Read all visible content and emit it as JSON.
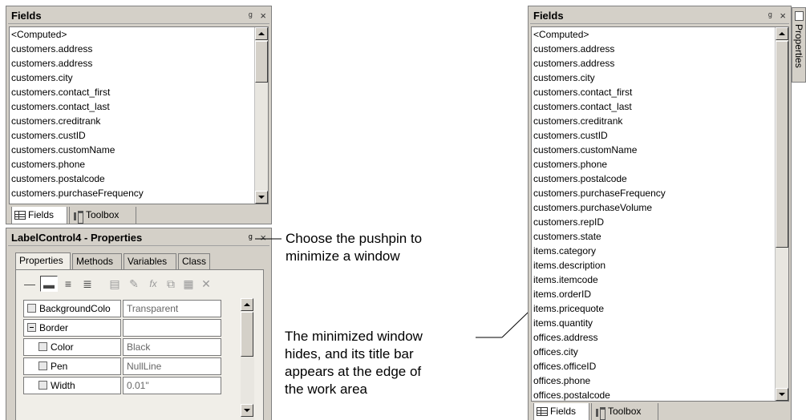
{
  "left_fields": {
    "title": "Fields",
    "pin": "p",
    "close": "×",
    "items": [
      "<Computed>",
      "customers.address",
      "customers.address",
      "customers.city",
      "customers.contact_first",
      "customers.contact_last",
      "customers.creditrank",
      "customers.custID",
      "customers.customName",
      "customers.phone",
      "customers.postalcode",
      "customers.purchaseFrequency"
    ],
    "tabs": [
      "Fields",
      "Toolbox"
    ]
  },
  "properties": {
    "title": "LabelControl4 - Properties",
    "tabs": [
      "Properties",
      "Methods",
      "Variables",
      "Class"
    ],
    "rows": [
      {
        "name": "BackgroundColo",
        "value": "Transparent",
        "indent": 0,
        "box": "plain"
      },
      {
        "name": "Border",
        "value": "",
        "indent": 0,
        "box": "minus"
      },
      {
        "name": "Color",
        "value": "Black",
        "indent": 1,
        "box": "plain"
      },
      {
        "name": "Pen",
        "value": "NullLine",
        "indent": 1,
        "box": "plain"
      },
      {
        "name": "Width",
        "value": "0.01\"",
        "indent": 1,
        "box": "plain"
      }
    ]
  },
  "annotations": {
    "pushpin": [
      "Choose the pushpin to",
      "minimize a window"
    ],
    "minimized": [
      "The minimized window",
      "hides, and its title bar",
      "appears at the edge of",
      "the work area"
    ]
  },
  "right_fields": {
    "title": "Fields",
    "items": [
      "<Computed>",
      "customers.address",
      "customers.address",
      "customers.city",
      "customers.contact_first",
      "customers.contact_last",
      "customers.creditrank",
      "customers.custID",
      "customers.customName",
      "customers.phone",
      "customers.postalcode",
      "customers.purchaseFrequency",
      "customers.purchaseVolume",
      "customers.repID",
      "customers.state",
      "items.category",
      "items.description",
      "items.itemcode",
      "items.orderID",
      "items.pricequote",
      "items.quantity",
      "offices.address",
      "offices.city",
      "offices.officeID",
      "offices.phone",
      "offices.postalcode"
    ],
    "tabs": [
      "Fields",
      "Toolbox"
    ]
  },
  "side_tab": {
    "label": "Properties"
  }
}
